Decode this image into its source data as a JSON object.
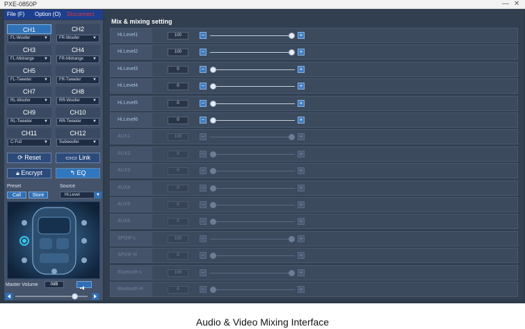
{
  "window": {
    "title": "PXE-0850P",
    "minimize_glyph": "—",
    "close_glyph": "✕"
  },
  "menu": {
    "file": "File (F)",
    "option": "Option (O)",
    "status": "Disconnect"
  },
  "channels": [
    {
      "name": "CH1",
      "select": "FL-Woofer",
      "active": true
    },
    {
      "name": "CH2",
      "select": "FR-Woofer",
      "active": false
    },
    {
      "name": "CH3",
      "select": "FL-Midrange",
      "active": false
    },
    {
      "name": "CH4",
      "select": "FR-Midrange",
      "active": false
    },
    {
      "name": "CH5",
      "select": "FL-Tweeter",
      "active": false
    },
    {
      "name": "CH6",
      "select": "FR-Tweeter",
      "active": false
    },
    {
      "name": "CH7",
      "select": "RL-Woofer",
      "active": false
    },
    {
      "name": "CH8",
      "select": "RR-Woofer",
      "active": false
    },
    {
      "name": "CH9",
      "select": "RL-Tweeter",
      "active": false
    },
    {
      "name": "CH10",
      "select": "RR-Tweeter",
      "active": false
    },
    {
      "name": "CH11",
      "select": "C-Full",
      "active": false
    },
    {
      "name": "CH12",
      "select": "Subwoofer",
      "active": false
    }
  ],
  "buttons": {
    "reset": "Reset",
    "link": "Link",
    "encrypt": "Encrypt",
    "eq": "EQ"
  },
  "preset": {
    "label": "Preset",
    "call": "Call",
    "store": "Store"
  },
  "source": {
    "label": "Source",
    "value": "Hi.Level"
  },
  "master_volume": {
    "label": "Master Volume",
    "value": "0dB",
    "level": 0.85
  },
  "mix": {
    "title": "Mix & mixing setting",
    "rows": [
      {
        "label": "Hi.Level1",
        "value": "100",
        "level": 1.0,
        "enabled": true
      },
      {
        "label": "Hi.Level2",
        "value": "100",
        "level": 1.0,
        "enabled": true
      },
      {
        "label": "Hi.Level3",
        "value": "0",
        "level": 0.0,
        "enabled": true
      },
      {
        "label": "Hi.Level4",
        "value": "0",
        "level": 0.0,
        "enabled": true
      },
      {
        "label": "Hi.Level5",
        "value": "0",
        "level": 0.0,
        "enabled": true
      },
      {
        "label": "Hi.Level6",
        "value": "0",
        "level": 0.0,
        "enabled": true
      },
      {
        "label": "AUX1",
        "value": "100",
        "level": 1.0,
        "enabled": false
      },
      {
        "label": "AUX2",
        "value": "0",
        "level": 0.0,
        "enabled": false
      },
      {
        "label": "AUX3",
        "value": "0",
        "level": 0.0,
        "enabled": false
      },
      {
        "label": "AUX4",
        "value": "0",
        "level": 0.0,
        "enabled": false
      },
      {
        "label": "AUX5",
        "value": "0",
        "level": 0.0,
        "enabled": false
      },
      {
        "label": "AUX6",
        "value": "0",
        "level": 0.0,
        "enabled": false
      },
      {
        "label": "SPDIF-L",
        "value": "100",
        "level": 1.0,
        "enabled": false
      },
      {
        "label": "SPDIF-R",
        "value": "0",
        "level": 0.0,
        "enabled": false
      },
      {
        "label": "Bluetooth-L",
        "value": "100",
        "level": 1.0,
        "enabled": false
      },
      {
        "label": "Bluetooth-R",
        "value": "0",
        "level": 0.0,
        "enabled": false
      }
    ]
  },
  "caption": "Audio & Video Mixing Interface",
  "colors": {
    "accent": "#2f72b8",
    "disconnect": "#e23a3a",
    "panel": "#323f51"
  }
}
